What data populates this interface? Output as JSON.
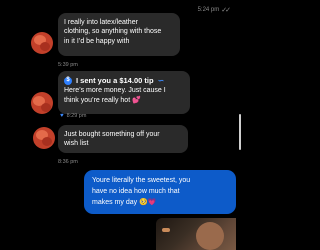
{
  "messages": {
    "top_time": "5:24 pm",
    "msg1": {
      "lines": [
        "I really into latex/leather",
        "clothing, so anything with those",
        "in it I’d be happy with"
      ],
      "time": "5:39 pm"
    },
    "msg2": {
      "tip_title": "I sent you a $14.00 tip",
      "tip_coin": "$",
      "lines": [
        "Here’s more money. Just cause I",
        "think you’re really hot 💕"
      ],
      "time": "8:29 pm"
    },
    "msg3": {
      "lines": [
        "Just bought something off your",
        "wish list"
      ],
      "time": "8:36 pm"
    },
    "sent1": {
      "lines": [
        "Youre literally the sweetest, you",
        "have no idea how much that",
        "makes my day 🥺💗"
      ]
    }
  },
  "colors": {
    "background": "#000000",
    "received_bubble": "#2a2a2a",
    "sent_bubble": "#0d5bc9",
    "tip_accent": "#2f80ff"
  }
}
